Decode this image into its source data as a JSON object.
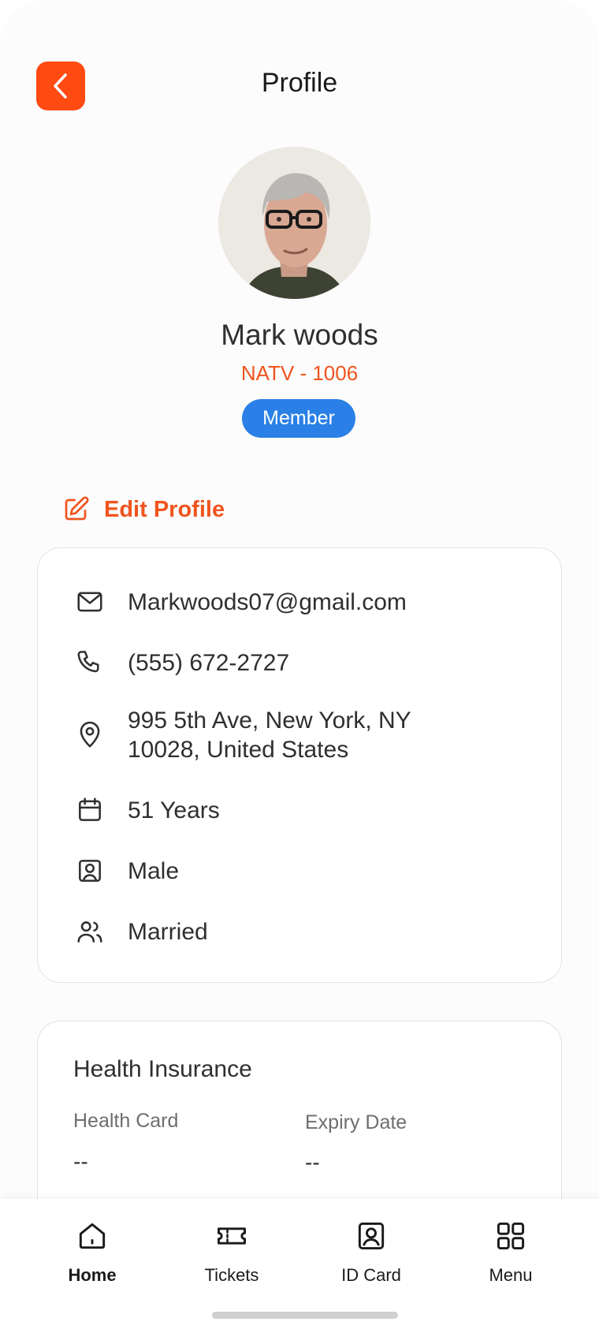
{
  "header": {
    "title": "Profile",
    "back_icon": "chevron-left-icon",
    "accent_color": "#FF4A12"
  },
  "profile": {
    "name": "Mark woods",
    "member_id": "NATV - 1006",
    "badge": "Member",
    "badge_color": "#2A80E6",
    "id_color": "#F0541E"
  },
  "edit_profile": {
    "label": "Edit Profile",
    "icon": "edit-icon"
  },
  "info": {
    "email": "Markwoods07@gmail.com",
    "phone": "(555) 672-2727",
    "address_line1": "995 5th Ave, New York, NY",
    "address_line2": "10028, United States",
    "age": "51 Years",
    "gender": "Male",
    "marital_status": "Married"
  },
  "insurance": {
    "title": "Health Insurance",
    "health_card_label": "Health Card",
    "health_card_value": "--",
    "expiry_label": "Expiry Date",
    "expiry_value": "--"
  },
  "nav": {
    "items": [
      {
        "label": "Home",
        "icon": "home-icon",
        "active": true
      },
      {
        "label": "Tickets",
        "icon": "ticket-icon",
        "active": false
      },
      {
        "label": "ID Card",
        "icon": "id-card-icon",
        "active": false
      },
      {
        "label": "Menu",
        "icon": "grid-menu-icon",
        "active": false
      }
    ]
  }
}
